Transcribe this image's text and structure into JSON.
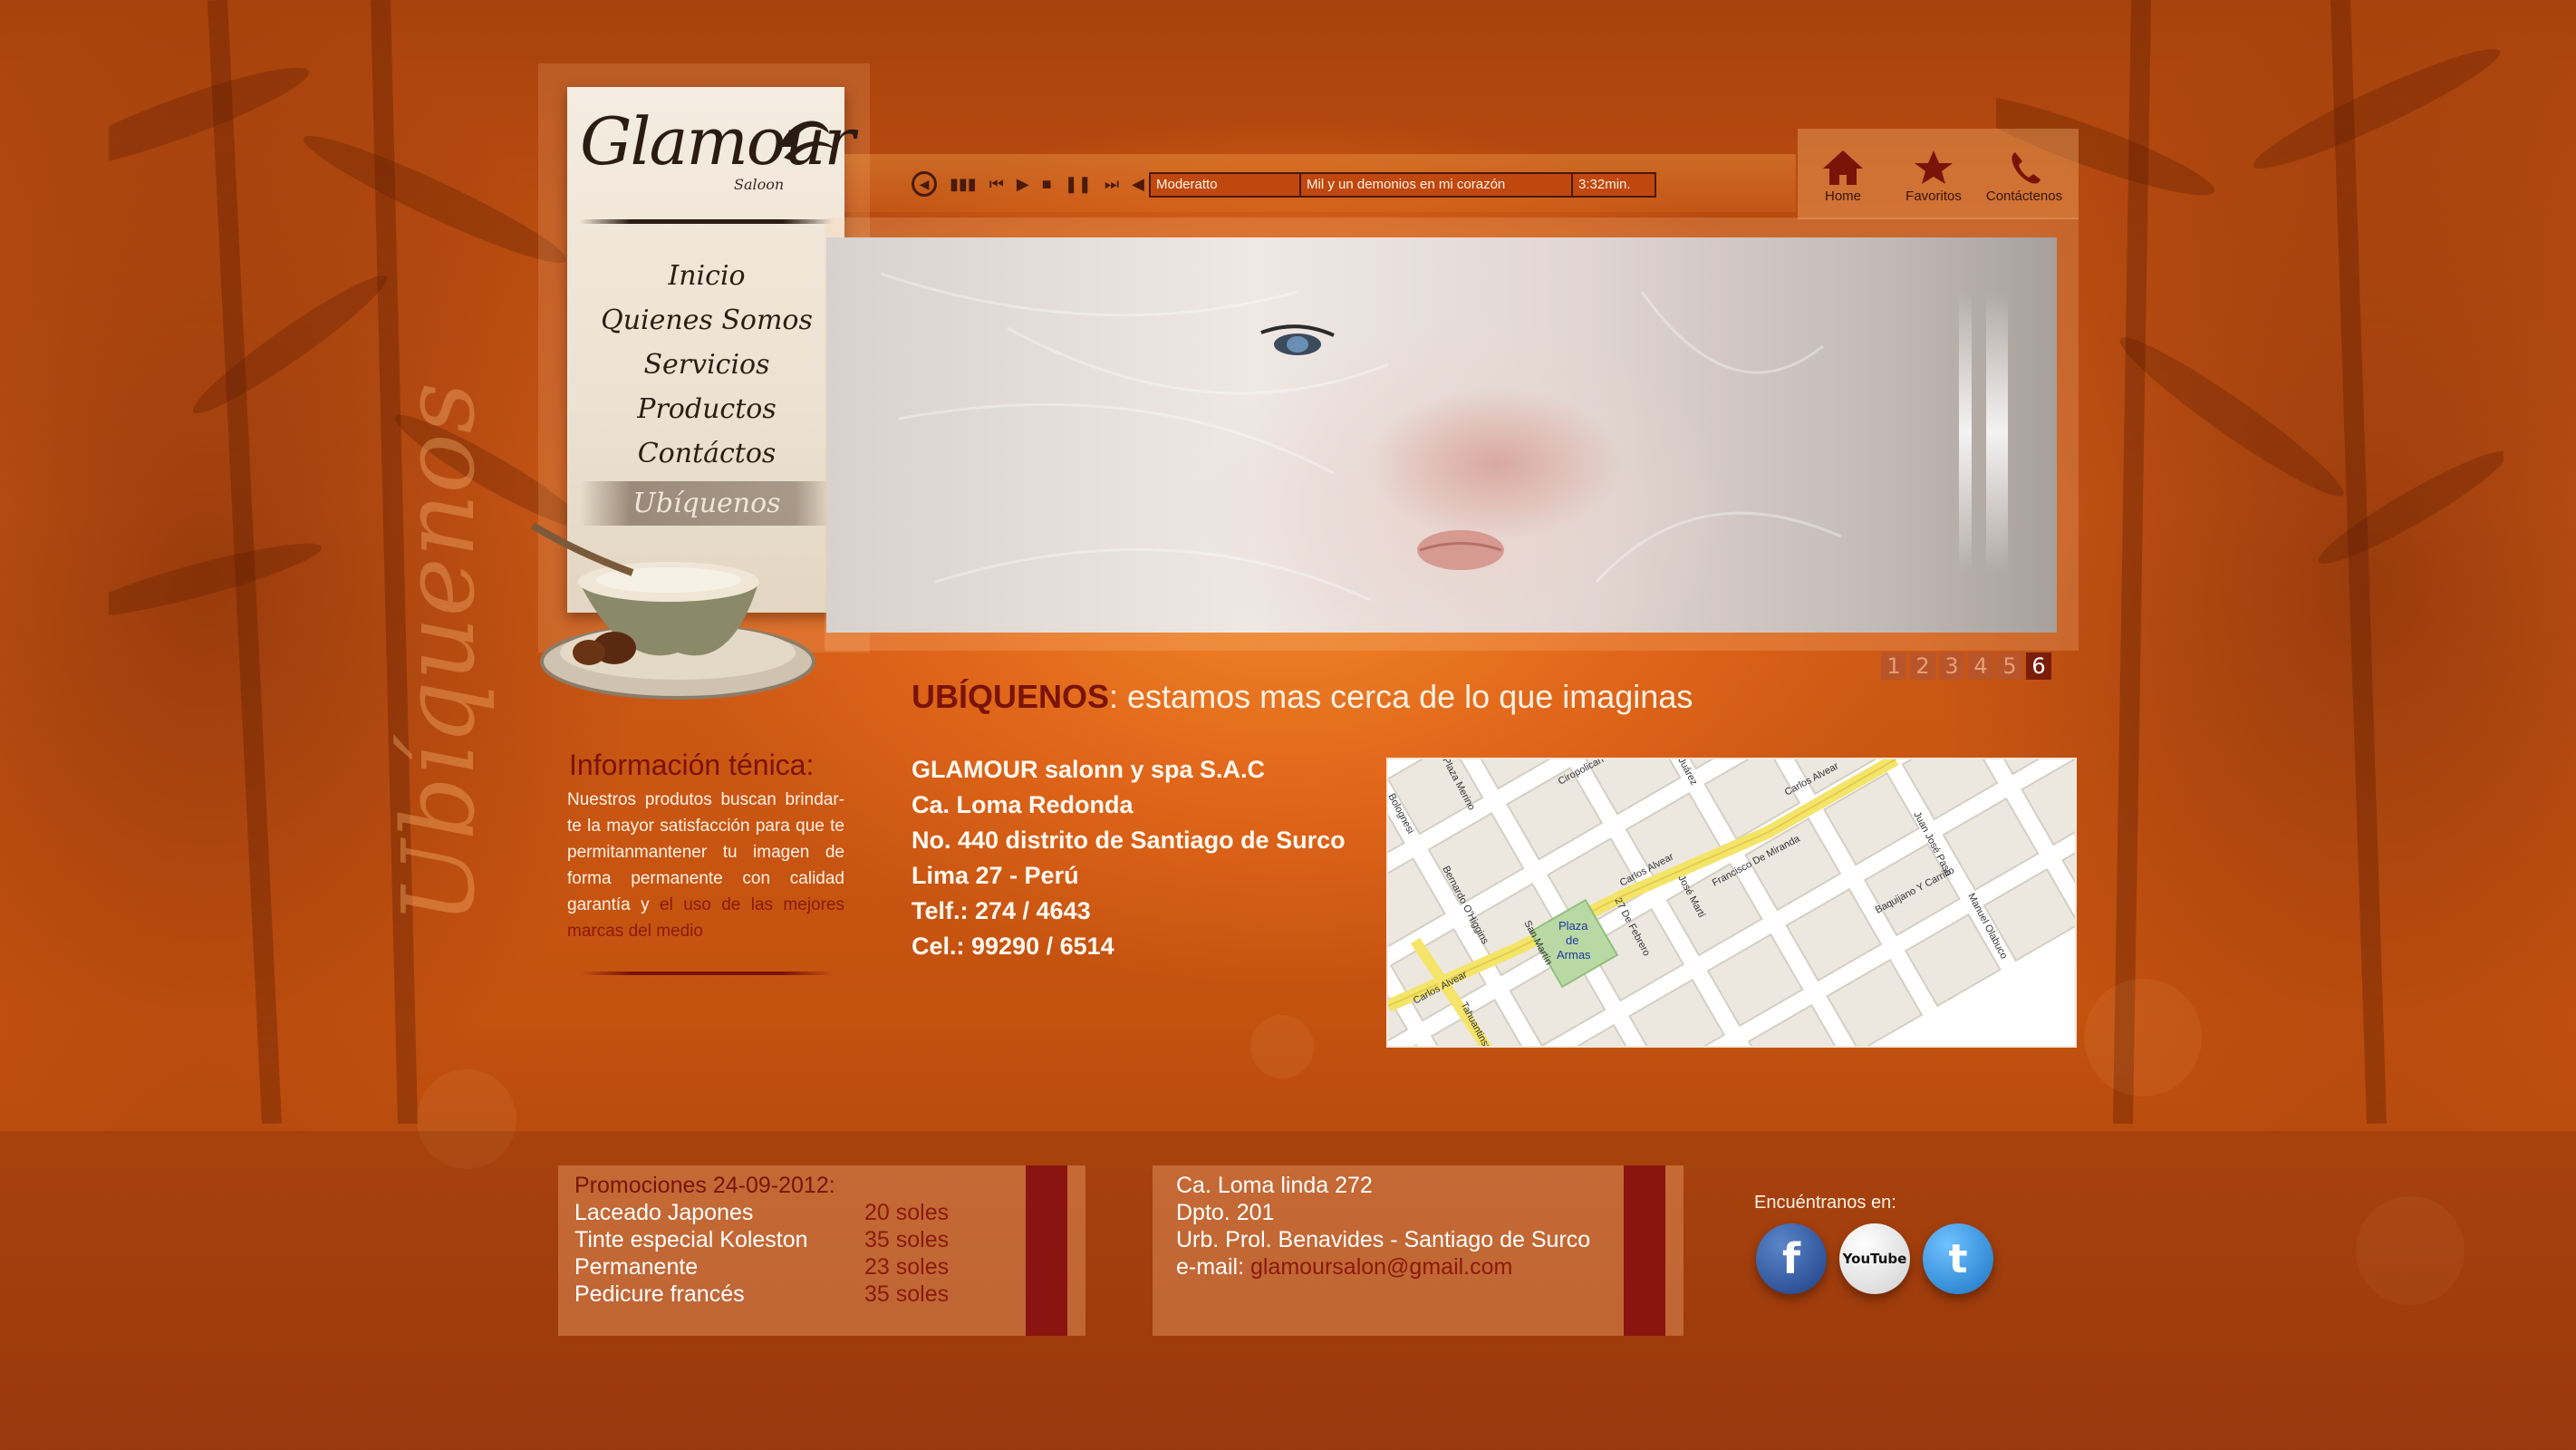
{
  "logo": {
    "name": "Glamour",
    "sub": "Saloon"
  },
  "nav": {
    "items": [
      "Inicio",
      "Quienes Somos",
      "Servicios",
      "Productos",
      "Contáctos",
      "Ubíquenos"
    ]
  },
  "player": {
    "song_style": "Moderatto",
    "song_title": "Mil y un demonios en mi corazón",
    "duration": "3:32min."
  },
  "topnav": {
    "home": "Home",
    "favorites": "Favoritos",
    "contact": "Contáctenos"
  },
  "pager": {
    "pages": [
      "1",
      "2",
      "3",
      "4",
      "5",
      "6"
    ],
    "active": "6"
  },
  "section": {
    "title_strong": "UBÍQUENOS",
    "title_rest": ": estamos mas cerca de lo que imaginas"
  },
  "info": {
    "title": "Información ténica:",
    "body": "Nuestros produtos buscan brindar-te la mayor satisfacción para que te permitanmantener tu imagen de forma permanente con calidad garantía y ",
    "highlight": "el uso de las mejores marcas del medio"
  },
  "side_word": "Ubíquenos",
  "address": {
    "line1": "GLAMOUR salonn y spa S.A.C",
    "line2": "Ca. Loma Redonda",
    "line3": "No. 440 distrito de Santiago de Surco",
    "line4": "Lima 27 - Perú",
    "line5": "Telf.: 274 / 4643",
    "line6": "Cel.: 99290 / 6514"
  },
  "map": {
    "plaza": [
      "Plaza",
      "de",
      "Armas"
    ],
    "streets": [
      "Carlos Alvear",
      "Carlos Alvear",
      "Carlos Alvear",
      "Bolognesi",
      "Plaza Merino",
      "Ciropolican",
      "Juárez",
      "Bernardo O'Higgins",
      "Tahuantinsuyo",
      "San Martín",
      "27 De Febrero",
      "José Martí",
      "Francisco De Miranda",
      "Baquijano Y Carrillo",
      "Manuel Olabuco",
      "Juan José Paso"
    ]
  },
  "promo": {
    "title": "Promociones 24-09-2012:",
    "items": [
      {
        "name": "Laceado Japones",
        "price": "20 soles"
      },
      {
        "name": "Tinte especial Koleston",
        "price": "35 soles"
      },
      {
        "name": "Permanente",
        "price": "23 soles"
      },
      {
        "name": "Pedicure francés",
        "price": "35 soles"
      }
    ]
  },
  "contact": {
    "line1": "Ca. Loma linda 272",
    "line2": "Dpto. 201",
    "line3": "Urb. Prol. Benavides - Santiago de Surco",
    "email_label": "e-mail: ",
    "email": "glamoursalon@gmail.com"
  },
  "social": {
    "title": "Encuéntranos en:",
    "items": [
      "facebook-icon",
      "youtube-icon",
      "twitter-icon"
    ],
    "youtube_text": "YouTube"
  },
  "colors": {
    "accent": "#7a1408",
    "background": "#d8621a",
    "footer_red": "#8a1410"
  }
}
